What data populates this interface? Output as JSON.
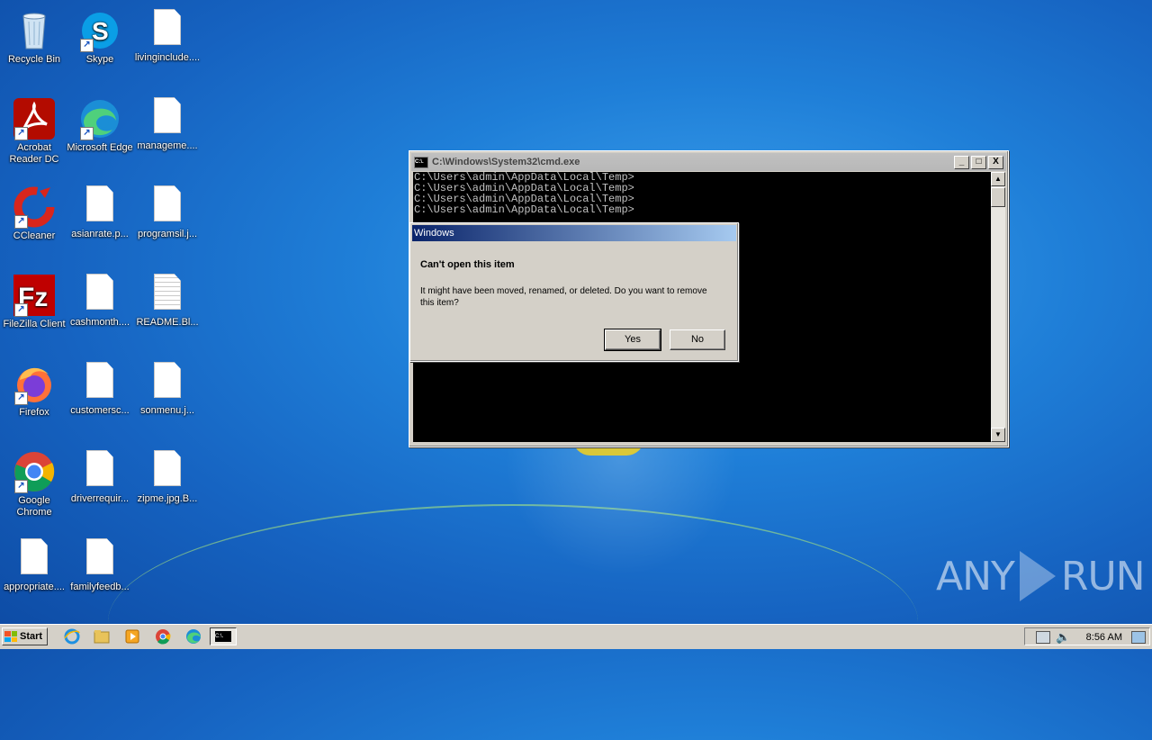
{
  "desktop": {
    "icons": [
      {
        "label": "Recycle Bin"
      },
      {
        "label": "Skype"
      },
      {
        "label": "livinginclude...."
      },
      {
        "label": "Acrobat Reader DC"
      },
      {
        "label": "Microsoft Edge"
      },
      {
        "label": "manageme...."
      },
      {
        "label": "CCleaner"
      },
      {
        "label": "asianrate.p..."
      },
      {
        "label": "programsil.j..."
      },
      {
        "label": "FileZilla Client"
      },
      {
        "label": "cashmonth...."
      },
      {
        "label": "README.Bl..."
      },
      {
        "label": "Firefox"
      },
      {
        "label": "customersc..."
      },
      {
        "label": "sonmenu.j..."
      },
      {
        "label": "Google Chrome"
      },
      {
        "label": "driverrequir..."
      },
      {
        "label": "zipme.jpg.B..."
      },
      {
        "label": "appropriate...."
      },
      {
        "label": "familyfeedb..."
      }
    ]
  },
  "cmd": {
    "title": "C:\\Windows\\System32\\cmd.exe",
    "icon_text": "C:\\.",
    "minimize": "_",
    "maximize": "□",
    "close": "X",
    "lines": [
      "C:\\Users\\admin\\AppData\\Local\\Temp>",
      "C:\\Users\\admin\\AppData\\Local\\Temp>",
      "C:\\Users\\admin\\AppData\\Local\\Temp>",
      "C:\\Users\\admin\\AppData\\Local\\Temp>"
    ]
  },
  "dialog": {
    "title": "Windows",
    "heading": "Can't open this item",
    "message": "It might have been moved, renamed, or deleted. Do you want to remove this item?",
    "yes_label": "Yes",
    "no_label": "No"
  },
  "taskbar": {
    "start_label": "Start",
    "clock": "8:56 AM",
    "cmd_label": "C:\\."
  },
  "watermark": {
    "left": "ANY",
    "right": "RUN"
  },
  "colors": {
    "desktop_bg": "#1f7fd8",
    "dialog_title_start": "#0a246a",
    "dialog_title_end": "#a6caf0"
  }
}
